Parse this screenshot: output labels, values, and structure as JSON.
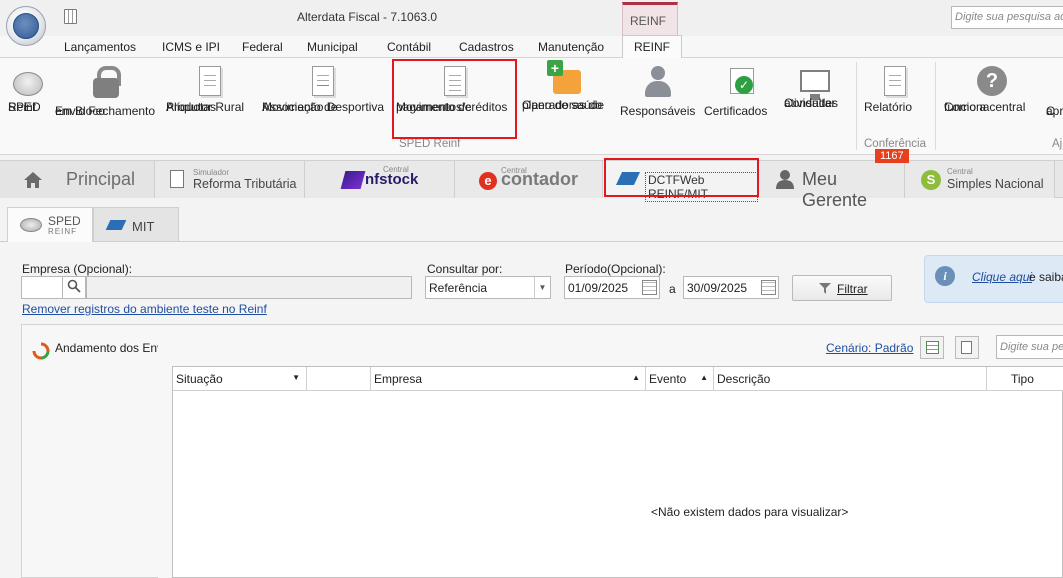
{
  "app": {
    "title": "Alterdata Fiscal - 7.1063.0",
    "contextual_tab_header": "REINF",
    "search_placeholder": "Digite sua pesquisa aqui"
  },
  "ribbon_tabs": [
    "Lançamentos",
    "ICMS e IPI",
    "Federal",
    "Municipal",
    "Contábil",
    "Cadastros",
    "Manutenção",
    "REINF"
  ],
  "ribbon": {
    "buttons": [
      {
        "l1": "SPED",
        "l2": "Reinf"
      },
      {
        "l1": "Envio Fechamento",
        "l2": "em Bloco"
      },
      {
        "l1": "Alíquotas",
        "l2": "Produtor Rural"
      },
      {
        "l1": "Movimento de",
        "l2": "Associação Desportiva"
      },
      {
        "l1": "Movimento de",
        "l2": "pagamentos/créditos"
      },
      {
        "l1": "Operadoras do",
        "l2": "plano de saúde"
      },
      {
        "l1": "Responsáveis",
        "l2": ""
      },
      {
        "l1": "Certificados",
        "l2": ""
      },
      {
        "l1": "Consultar",
        "l2": "atividades"
      },
      {
        "l1": "Relatório",
        "l2": ""
      },
      {
        "l1": "Como a central",
        "l2": "funciona"
      },
      {
        "l1": "C",
        "l2": "apr"
      }
    ],
    "groups": [
      "SPED Reinf",
      "Conferência",
      "Aj"
    ]
  },
  "main_tabs": {
    "principal": "Principal",
    "simulador_small": "Simulador",
    "simulador": "Reforma Tributária",
    "nfstock_small": "Central",
    "nfstock": "nfstock",
    "contador_small": "Central",
    "contador": "contador",
    "dctf": "DCTFWeb REINF/MIT",
    "gerente": "Meu Gerente",
    "gerente_badge": "1167",
    "simples_small": "Central",
    "simples": "Simples Nacional"
  },
  "sub_tabs": {
    "sped_top": "SPED",
    "sped_bottom": "REINF",
    "mit": "MIT"
  },
  "filters": {
    "empresa_label": "Empresa (Opcional):",
    "consultar_label": "Consultar por:",
    "consultar_value": "Referência",
    "periodo_label": "Período(Opcional):",
    "date_from": "01/09/2025",
    "date_sep": "a",
    "date_to": "30/09/2025",
    "filter_button": "Filtrar",
    "remove_link": "Remover registros do ambiente teste no Reinf",
    "info_link": "Clique aqui",
    "info_text": "e saiba"
  },
  "panel": {
    "andamento": "Andamento dos Envios",
    "cenario": "Cenário: Padrão",
    "search_placeholder": "Digite sua pes"
  },
  "grid": {
    "columns": [
      "Situação",
      "",
      "Empresa",
      "Evento",
      "Descrição",
      "Tipo"
    ],
    "empty_message": "<Não existem dados para visualizar>"
  }
}
